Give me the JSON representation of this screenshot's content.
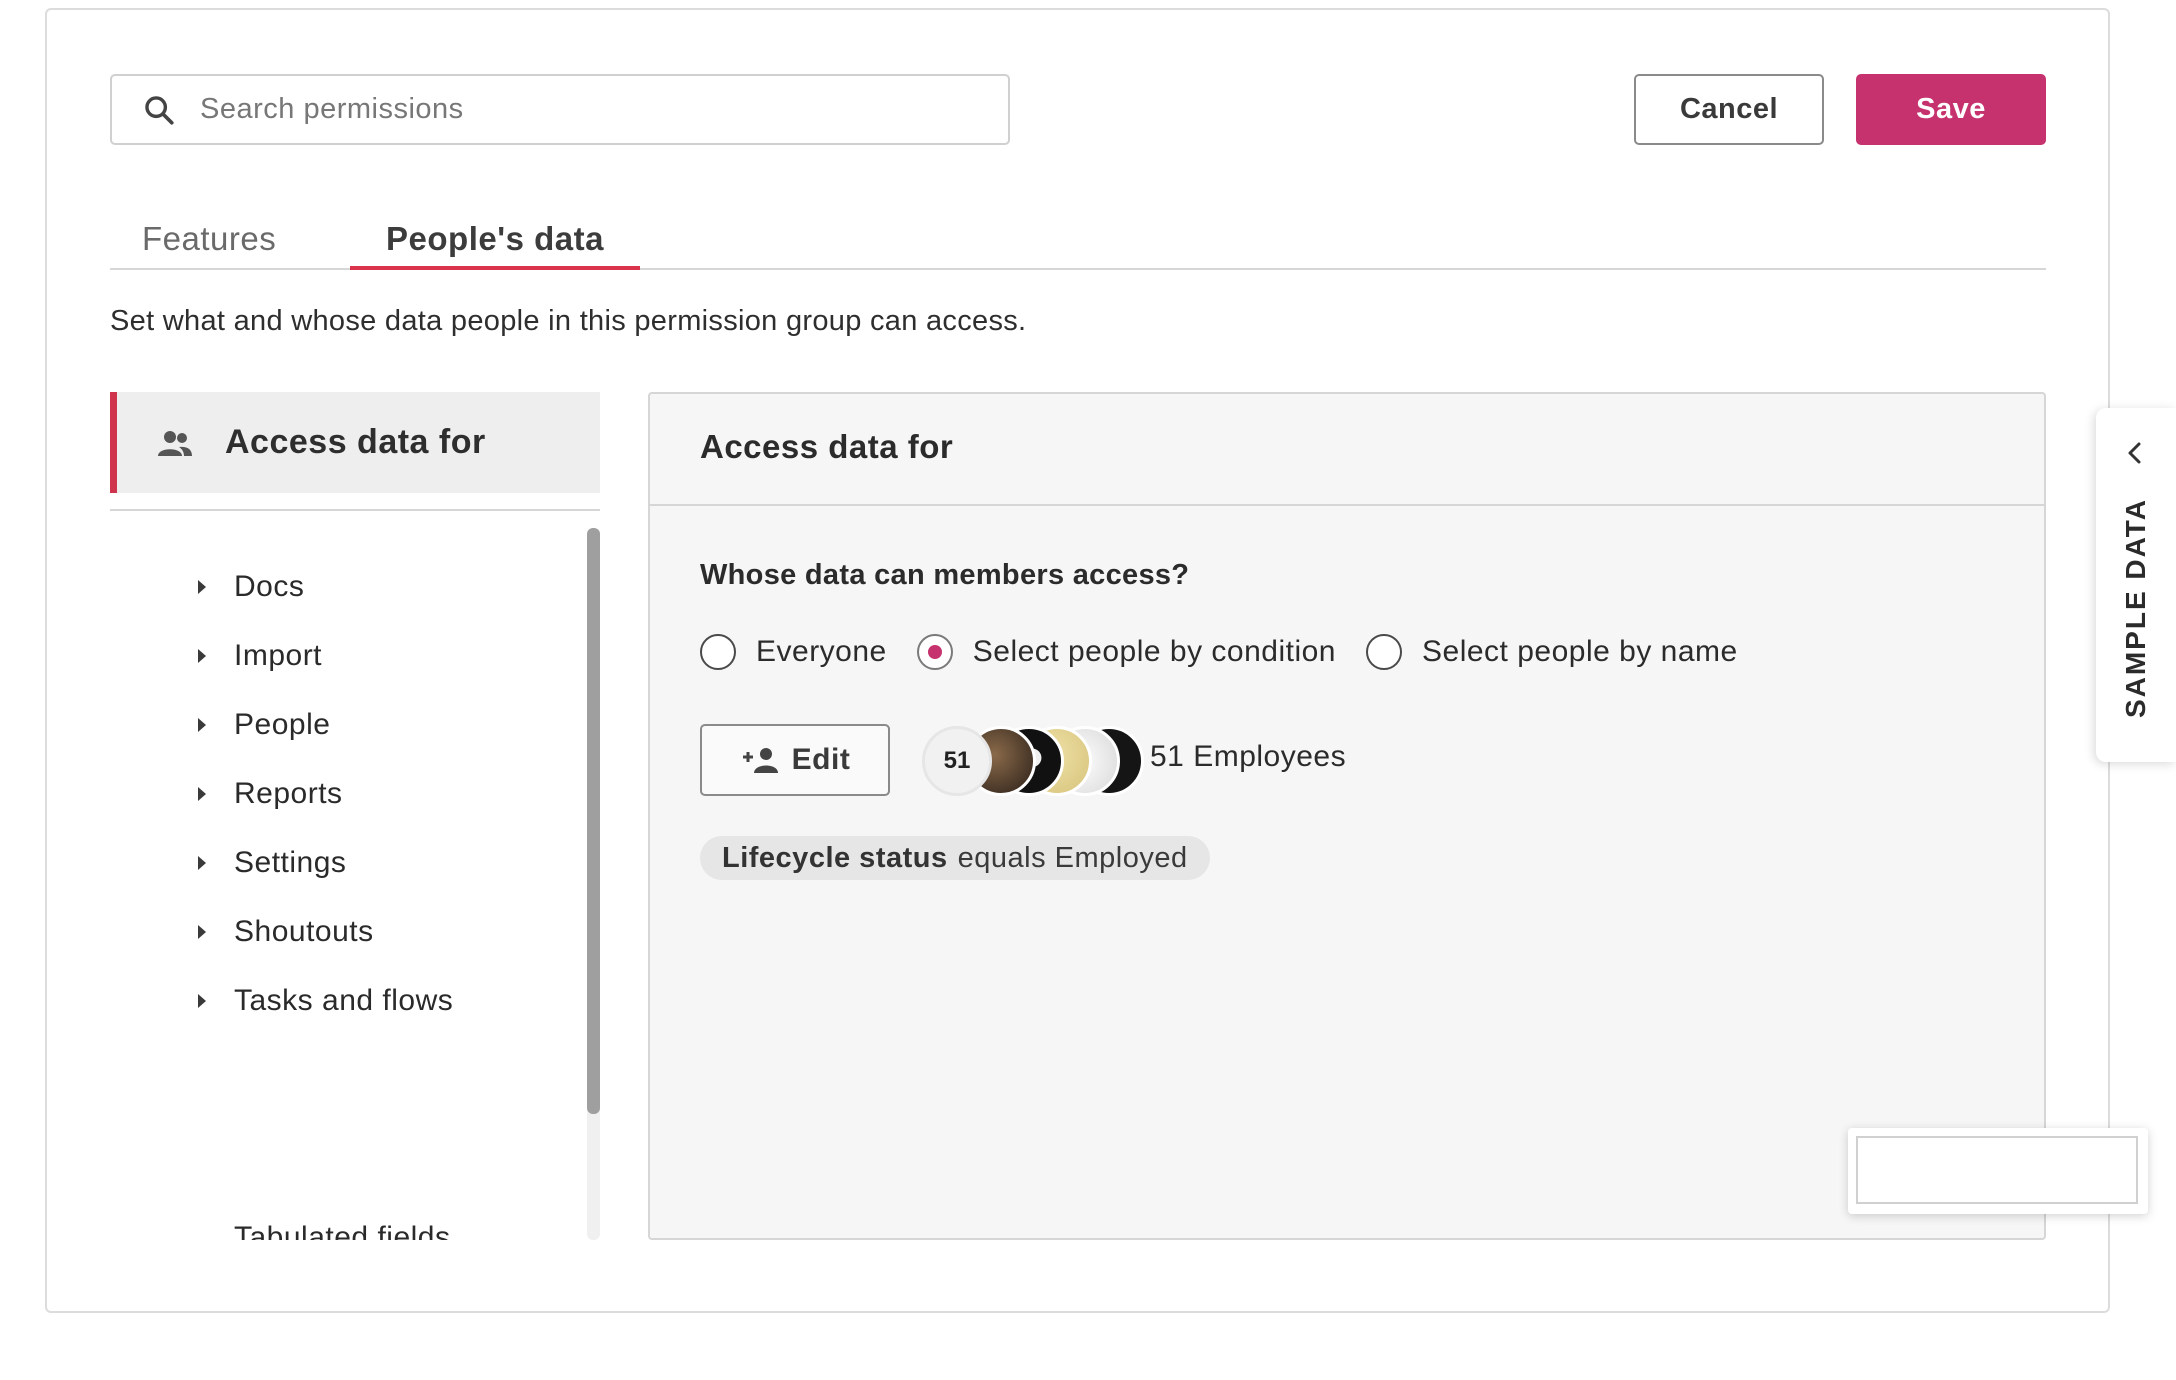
{
  "search": {
    "placeholder": "Search permissions"
  },
  "toolbar": {
    "cancel_label": "Cancel",
    "save_label": "Save",
    "save_color": "#c5326e"
  },
  "tabs": [
    {
      "label": "Features",
      "active": false
    },
    {
      "label": "People's data",
      "active": true
    }
  ],
  "description": "Set what and whose data people in this permission group can access.",
  "sidebar": {
    "header": {
      "label": "Access data for",
      "icon": "people-icon"
    },
    "items": [
      {
        "label": "Docs"
      },
      {
        "label": "Import"
      },
      {
        "label": "People"
      },
      {
        "label": "Reports"
      },
      {
        "label": "Settings"
      },
      {
        "label": "Shoutouts"
      },
      {
        "label": "Tasks and flows"
      },
      {
        "label": "Tabulated fields"
      }
    ]
  },
  "panel": {
    "title": "Access data for",
    "question": "Whose data can members access?",
    "options": [
      {
        "label": "Everyone",
        "checked": false
      },
      {
        "label": "Select people by condition",
        "checked": true
      },
      {
        "label": "Select people by name",
        "checked": false
      }
    ],
    "edit_label": "Edit",
    "avatar_count": "51",
    "employees_text": "51 Employees",
    "condition": {
      "field": "Lifecycle status",
      "rest": "equals Employed"
    }
  },
  "sample_tab": {
    "label": "SAMPLE DATA"
  },
  "accent_color": "#d0344c"
}
